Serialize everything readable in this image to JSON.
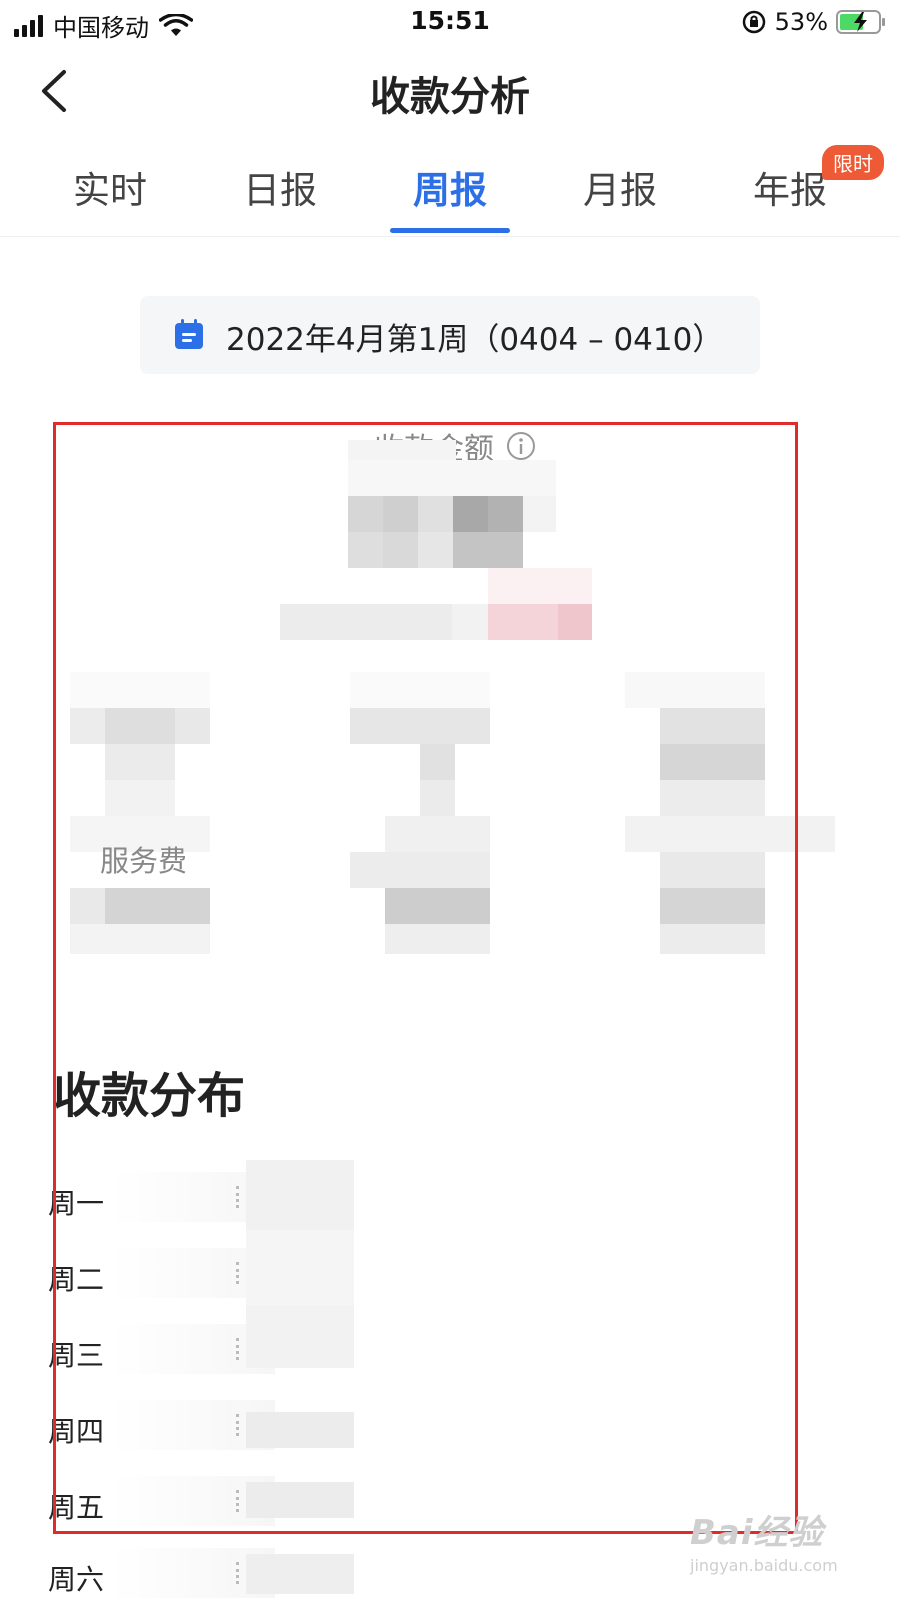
{
  "status_bar": {
    "carrier": "中国移动",
    "time": "15:51",
    "battery": "53%"
  },
  "nav": {
    "title": "收款分析"
  },
  "tabs": [
    {
      "label": "实时",
      "active": false
    },
    {
      "label": "日报",
      "active": false
    },
    {
      "label": "周报",
      "active": true
    },
    {
      "label": "月报",
      "active": false
    },
    {
      "label": "年报",
      "active": false,
      "badge": "限时"
    }
  ],
  "date_picker": {
    "text": "2022年4月第1周（0404 – 0410）"
  },
  "summary": {
    "amount_label": "收款金额",
    "service_label": "服务费"
  },
  "distribution": {
    "title": "收款分布",
    "days": [
      {
        "label": "周一"
      },
      {
        "label": "周二"
      },
      {
        "label": "周三"
      },
      {
        "label": "周四"
      },
      {
        "label": "周五"
      },
      {
        "label": "周六"
      }
    ]
  },
  "watermark": {
    "logo": "Bai经验",
    "url": "jingyan.baidu.com"
  },
  "colors": {
    "accent": "#2c6fe6",
    "badge": "#ee5a35",
    "highlight": "#e02b2b"
  }
}
